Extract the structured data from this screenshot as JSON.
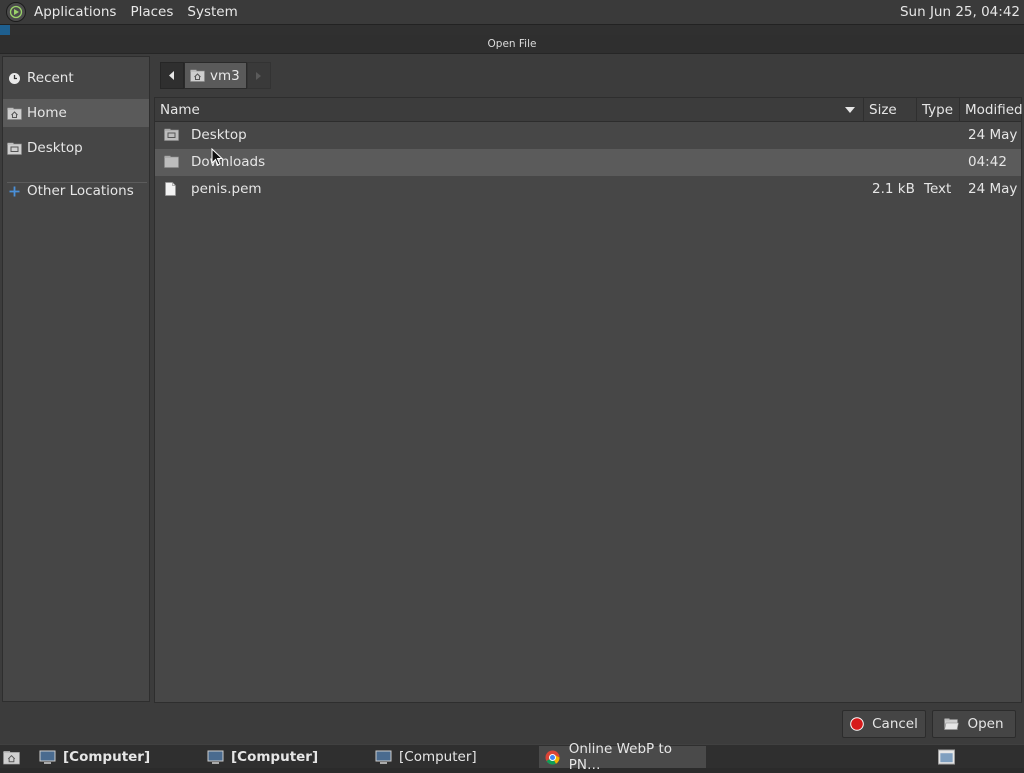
{
  "top_panel": {
    "menus": [
      "Applications",
      "Places",
      "System"
    ],
    "clock": "Sun Jun 25, 04:42",
    "logo_icon": "distro-logo-icon"
  },
  "dialog": {
    "title": "Open File",
    "sidebar": [
      {
        "label": "Recent",
        "icon": "clock-icon"
      },
      {
        "label": "Home",
        "icon": "home-folder-icon",
        "selected": true
      },
      {
        "label": "Desktop",
        "icon": "desktop-folder-icon"
      },
      {
        "label": "Other Locations",
        "icon": "plus-icon"
      }
    ],
    "pathbar": {
      "current": "vm3",
      "icon": "home-folder-icon"
    },
    "columns": {
      "name": "Name",
      "size": "Size",
      "type": "Type",
      "modified": "Modified"
    },
    "files": [
      {
        "name": "Desktop",
        "size": "",
        "type": "",
        "modified": "24 May",
        "icon": "folder-icon"
      },
      {
        "name": "Downloads",
        "size": "",
        "type": "",
        "modified": "04:42",
        "icon": "folder-icon",
        "selected": true
      },
      {
        "name": "penis.pem",
        "size": "2.1 kB",
        "type": "Text",
        "modified": "24 May",
        "icon": "file-icon"
      }
    ],
    "buttons": {
      "cancel": "Cancel",
      "open": "Open"
    }
  },
  "taskbar": {
    "items": [
      {
        "label": "[Computer]",
        "bold": true
      },
      {
        "label": "[Computer]",
        "bold": true
      },
      {
        "label": "[Computer]",
        "bold": false
      },
      {
        "label": "Online WebP to PN…",
        "bold": false,
        "icon": "chrome-icon",
        "active": true
      }
    ]
  },
  "colors": {
    "accent_blue": "#4a90d9",
    "cancel_red": "#d61a1a",
    "selection": "#5b5b5b"
  }
}
